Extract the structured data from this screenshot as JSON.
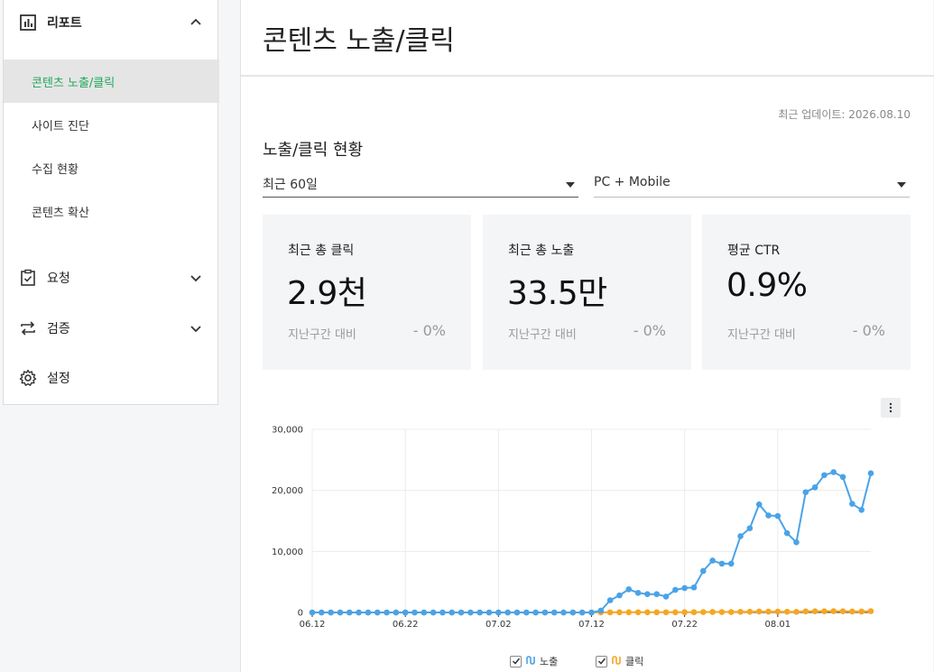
{
  "sidebar": {
    "report": {
      "label": "리포트",
      "icon": "bar-chart-icon",
      "expanded": true
    },
    "report_items": [
      {
        "label": "콘텐츠 노출/클릭",
        "active": true
      },
      {
        "label": "사이트 진단",
        "active": false
      },
      {
        "label": "수집 현황",
        "active": false
      },
      {
        "label": "콘텐츠 확산",
        "active": false
      }
    ],
    "request": {
      "label": "요청",
      "icon": "clipboard-check-icon"
    },
    "verify": {
      "label": "검증",
      "icon": "swap-arrows-icon"
    },
    "settings": {
      "label": "설정",
      "icon": "gear-icon"
    }
  },
  "main": {
    "title": "콘텐츠 노출/클릭",
    "updated": "최근 업데이트: 2026.08.10",
    "section_title": "노출/클릭 현황",
    "period_select": "최근 60일",
    "device_select": "PC + Mobile",
    "cards": [
      {
        "label": "최근 총 클릭",
        "value": "2.9천",
        "compare": "지난구간 대비",
        "delta": "- 0%"
      },
      {
        "label": "최근 총 노출",
        "value": "33.5만",
        "compare": "지난구간 대비",
        "delta": "- 0%"
      },
      {
        "label": "평균 CTR",
        "value": "0.9%",
        "compare": "지난구간 대비",
        "delta": "- 0%"
      }
    ]
  },
  "colors": {
    "accent_green": "#1fa85a",
    "impressions": "#4aa3e8",
    "clicks": "#f5a623"
  },
  "chart_data": {
    "type": "line",
    "x_start": "06.12",
    "x_end": "08.09",
    "x_ticks": [
      "06.12",
      "06.22",
      "07.02",
      "07.12",
      "07.22",
      "08.01"
    ],
    "ylim": [
      0,
      30000
    ],
    "y_ticks": [
      0,
      10000,
      20000,
      30000
    ],
    "y_tick_labels": [
      "0",
      "10,000",
      "20,000",
      "30,000"
    ],
    "grid": true,
    "legend_position": "bottom",
    "series": [
      {
        "name": "노출",
        "color": "#4aa3e8",
        "values": [
          0,
          0,
          0,
          0,
          0,
          0,
          0,
          0,
          0,
          0,
          0,
          0,
          0,
          0,
          0,
          0,
          0,
          0,
          0,
          0,
          0,
          0,
          0,
          0,
          0,
          0,
          0,
          0,
          0,
          0,
          0,
          300,
          2000,
          2800,
          3800,
          3200,
          3000,
          3000,
          2600,
          3700,
          4000,
          4100,
          6800,
          8500,
          8000,
          8000,
          12500,
          13800,
          17700,
          15900,
          15800,
          13000,
          11500,
          19700,
          20500,
          22500,
          23000,
          22200,
          17800,
          16800,
          22800
        ]
      },
      {
        "name": "클릭",
        "color": "#f5a623",
        "values": [
          0,
          0,
          0,
          0,
          0,
          0,
          0,
          0,
          0,
          0,
          0,
          0,
          0,
          0,
          0,
          0,
          0,
          0,
          0,
          0,
          0,
          0,
          0,
          0,
          0,
          0,
          0,
          0,
          0,
          0,
          0,
          10,
          20,
          30,
          30,
          30,
          30,
          30,
          30,
          30,
          40,
          40,
          60,
          80,
          70,
          70,
          110,
          120,
          160,
          140,
          140,
          120,
          100,
          180,
          190,
          200,
          210,
          200,
          160,
          150,
          210
        ]
      }
    ]
  }
}
